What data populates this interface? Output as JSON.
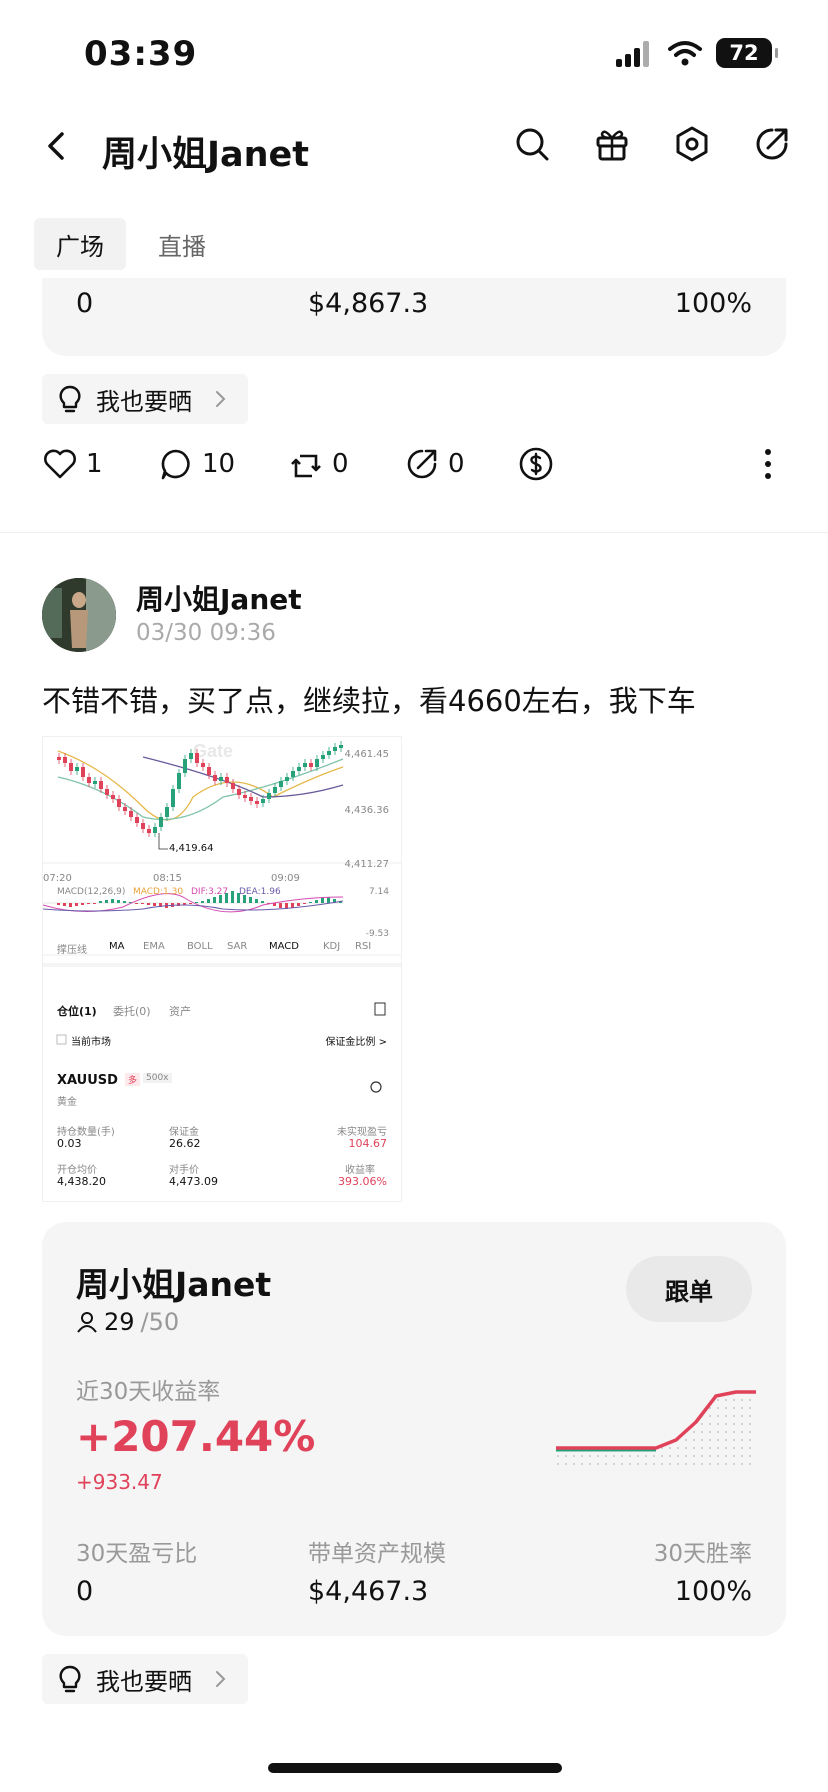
{
  "status_bar": {
    "time": "03:39",
    "battery": "72"
  },
  "header": {
    "title": "周小姐Janet"
  },
  "tabs": [
    {
      "label": "广场",
      "active": true
    },
    {
      "label": "直播",
      "active": false
    }
  ],
  "prev_card": {
    "profit_loss_ratio": "0",
    "assets": "$4,867.3",
    "win_rate": "100%"
  },
  "share_label": "我也要晒",
  "actions": {
    "likes": "1",
    "comments": "10",
    "reposts": "0",
    "shares": "0"
  },
  "post": {
    "author": "周小姐Janet",
    "time": "03/30 09:36",
    "text": "不错不错，买了点，继续拉，看4660左右，我下车"
  },
  "screenshot": {
    "price_top": "4,461.45",
    "price_mid": "4,436.36",
    "price_bottom": "4,411.27",
    "low_label": "4,419.64",
    "watermark": "Gate",
    "times": [
      "07:20",
      "08:15",
      "09:09"
    ],
    "macd_title": "MACD(12,26,9)",
    "macd_val": "MACD:1.30",
    "dif_val": "DIF:3.27",
    "dea_val": "DEA:1.96",
    "macd_top": "7.14",
    "macd_bottom": "-9.53",
    "indicators": [
      "撑压线",
      "MA",
      "EMA",
      "BOLL",
      "SAR",
      "MACD",
      "KDJ",
      "RSI"
    ],
    "pos_tabs": [
      "仓位(1)",
      "委托(0)",
      "资产"
    ],
    "current_market": "当前市场",
    "margin_ratio": "保证金比例 >",
    "symbol": "XAUUSD",
    "side_badge": "多",
    "leverage": "500x",
    "symbol_cn": "黄金",
    "fields": [
      {
        "label": "持仓数量(手)",
        "value": "0.03"
      },
      {
        "label": "保证金",
        "value": "26.62"
      },
      {
        "label": "未实现盈亏",
        "value": "104.67"
      },
      {
        "label": "开仓均价",
        "value": "4,438.20"
      },
      {
        "label": "对手价",
        "value": "4,473.09"
      },
      {
        "label": "收益率",
        "value": "393.06%"
      }
    ]
  },
  "copy_card": {
    "name": "周小姐Janet",
    "followers": "29",
    "followers_max": "/50",
    "follow_button": "跟单",
    "roi_label": "近30天收益率",
    "roi": "+207.44%",
    "pnl": "+933.47",
    "stats": [
      {
        "label": "30天盈亏比",
        "value": "0"
      },
      {
        "label": "带单资产规模",
        "value": "$4,467.3"
      },
      {
        "label": "30天胜率",
        "value": "100%"
      }
    ]
  },
  "colors": {
    "accent_red": "#e0425a",
    "card_bg": "#f5f5f5",
    "up_green": "#27a17a"
  }
}
